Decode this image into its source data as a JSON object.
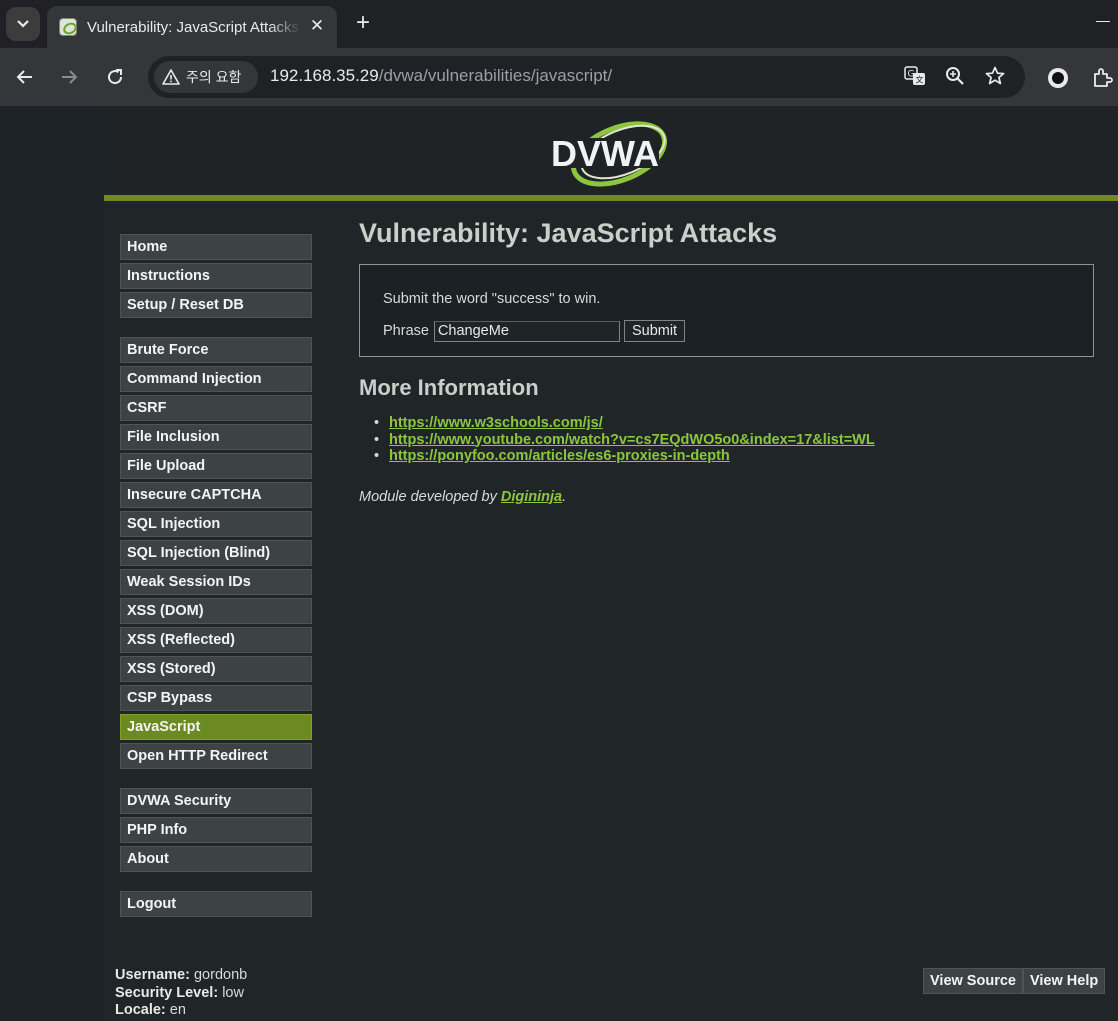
{
  "browser": {
    "tab_title": "Vulnerability: JavaScript Attacks",
    "url_host": "192.168.35.29",
    "url_path": "/dvwa/vulnerabilities/javascript/",
    "security_chip": "주의 요함"
  },
  "logo_text": "DVWA",
  "menu": {
    "group1": [
      {
        "label": "Home"
      },
      {
        "label": "Instructions"
      },
      {
        "label": "Setup / Reset DB"
      }
    ],
    "group2": [
      {
        "label": "Brute Force"
      },
      {
        "label": "Command Injection"
      },
      {
        "label": "CSRF"
      },
      {
        "label": "File Inclusion"
      },
      {
        "label": "File Upload"
      },
      {
        "label": "Insecure CAPTCHA"
      },
      {
        "label": "SQL Injection"
      },
      {
        "label": "SQL Injection (Blind)"
      },
      {
        "label": "Weak Session IDs"
      },
      {
        "label": "XSS (DOM)"
      },
      {
        "label": "XSS (Reflected)"
      },
      {
        "label": "XSS (Stored)"
      },
      {
        "label": "CSP Bypass"
      },
      {
        "label": "JavaScript",
        "selected": true
      },
      {
        "label": "Open HTTP Redirect"
      }
    ],
    "group3": [
      {
        "label": "DVWA Security"
      },
      {
        "label": "PHP Info"
      },
      {
        "label": "About"
      }
    ],
    "group4": [
      {
        "label": "Logout"
      }
    ]
  },
  "main": {
    "title": "Vulnerability: JavaScript Attacks",
    "instruction": "Submit the word \"success\" to win.",
    "phrase_label": "Phrase",
    "phrase_value": "ChangeMe",
    "submit_label": "Submit",
    "more_info_heading": "More Information",
    "links": [
      "https://www.w3schools.com/js/",
      "https://www.youtube.com/watch?v=cs7EQdWO5o0&index=17&list=WL",
      "https://ponyfoo.com/articles/es6-proxies-in-depth"
    ],
    "credit_prefix": "Module developed by ",
    "credit_author": "Digininja",
    "credit_suffix": "."
  },
  "footer": {
    "username_label": "Username:",
    "username": "gordonb",
    "security_label": "Security Level:",
    "security": "low",
    "locale_label": "Locale:",
    "locale": "en",
    "view_source": "View Source",
    "view_help": "View Help"
  },
  "colors": {
    "accent_green": "#708a26",
    "link_green": "#8cc63f",
    "selected_menu": "#6b8a21"
  }
}
